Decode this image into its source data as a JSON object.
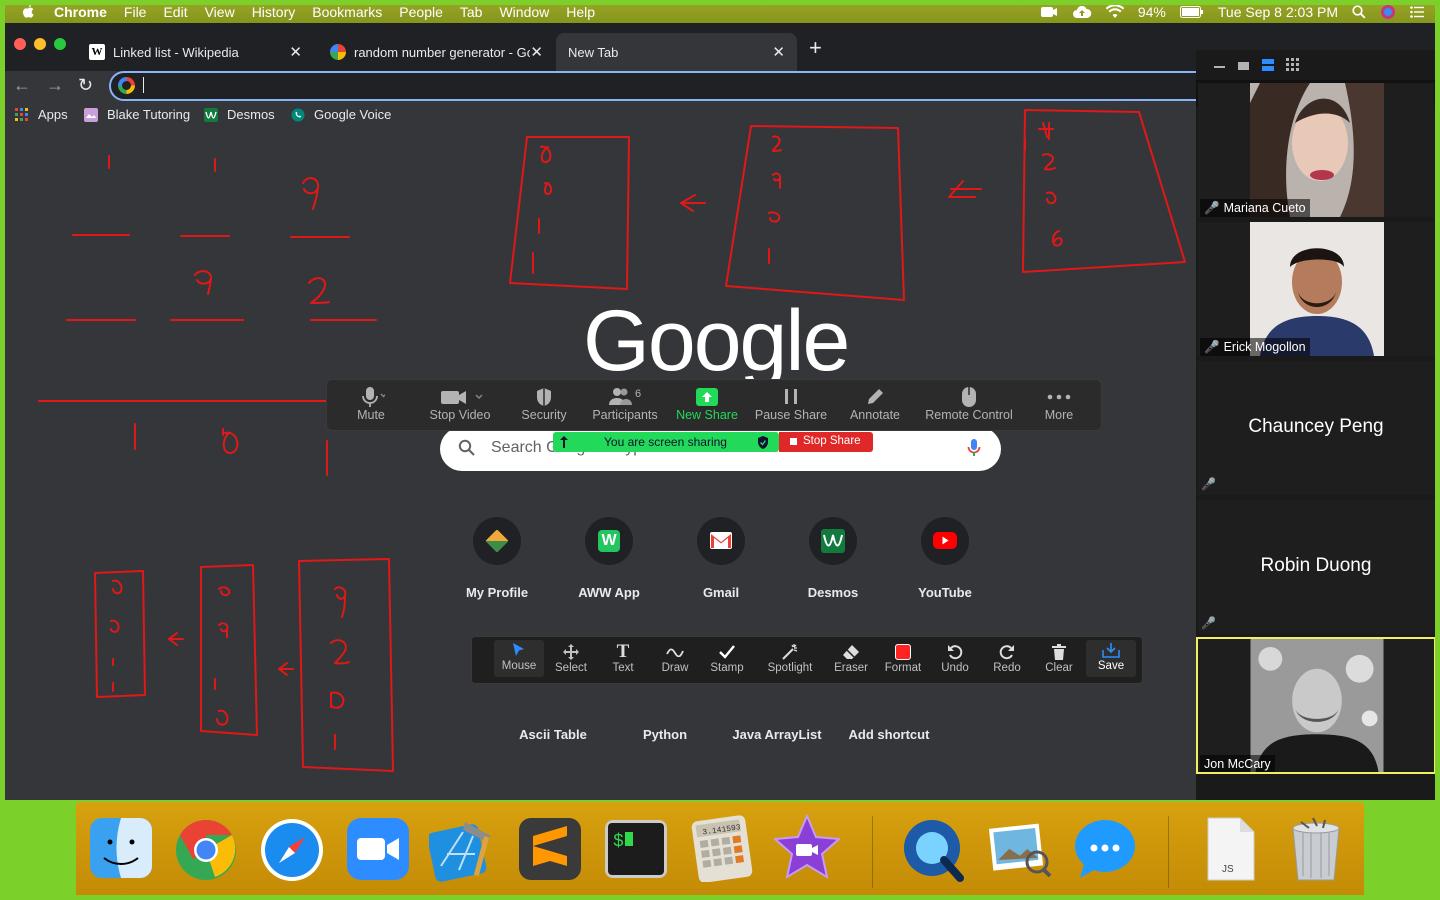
{
  "menubar": {
    "app": "Chrome",
    "items": [
      "File",
      "Edit",
      "View",
      "History",
      "Bookmarks",
      "People",
      "Tab",
      "Window",
      "Help"
    ],
    "battery": "94%",
    "datetime": "Tue Sep 8  2:03 PM"
  },
  "tabs": [
    {
      "title": "Linked list - Wikipedia",
      "favicon": "W"
    },
    {
      "title": "random number generator - Go",
      "favicon": "G"
    },
    {
      "title": "New Tab",
      "favicon": ""
    }
  ],
  "omnibox": {
    "value": ""
  },
  "bookmarks": [
    {
      "label": "Apps",
      "icon": "apps-grid-icon"
    },
    {
      "label": "Blake Tutoring",
      "icon": "blake-tutoring-icon"
    },
    {
      "label": "Desmos",
      "icon": "desmos-icon"
    },
    {
      "label": "Google Voice",
      "icon": "google-voice-icon"
    }
  ],
  "google": {
    "logo": "Google",
    "search_placeholder": "Search Google or type a URL"
  },
  "shortcuts_row1": [
    {
      "label": "My Profile",
      "color": "#f2a93b"
    },
    {
      "label": "AWW App",
      "color": "#22c55e"
    },
    {
      "label": "Gmail",
      "color": "#ea4335"
    },
    {
      "label": "Desmos",
      "color": "#127a3d"
    },
    {
      "label": "YouTube",
      "color": "#ff0000"
    }
  ],
  "shortcuts_row2": [
    {
      "label": "Ascii Table"
    },
    {
      "label": "Python"
    },
    {
      "label": "Java ArrayList"
    },
    {
      "label": "Add shortcut"
    }
  ],
  "zoom_toolbar": {
    "buttons": [
      {
        "label": "Mute",
        "icon": "microphone-icon"
      },
      {
        "label": "Stop Video",
        "icon": "video-camera-icon"
      },
      {
        "label": "Security",
        "icon": "shield-icon"
      },
      {
        "label": "Participants",
        "icon": "participants-icon",
        "count": "6"
      },
      {
        "label": "New Share",
        "icon": "share-screen-icon"
      },
      {
        "label": "Pause Share",
        "icon": "pause-icon"
      },
      {
        "label": "Annotate",
        "icon": "pencil-icon"
      },
      {
        "label": "Remote Control",
        "icon": "mouse-icon"
      },
      {
        "label": "More",
        "icon": "ellipsis-icon"
      }
    ],
    "sharing_status": "You are screen sharing",
    "stop_share": "Stop Share"
  },
  "annotate_toolbar": {
    "tools": [
      {
        "label": "Mouse",
        "icon": "cursor-icon"
      },
      {
        "label": "Select",
        "icon": "move-icon"
      },
      {
        "label": "Text",
        "icon": "text-icon"
      },
      {
        "label": "Draw",
        "icon": "squiggle-icon"
      },
      {
        "label": "Stamp",
        "icon": "checkmark-icon"
      },
      {
        "label": "Spotlight",
        "icon": "spotlight-icon"
      },
      {
        "label": "Eraser",
        "icon": "eraser-icon"
      },
      {
        "label": "Format",
        "icon": "format-icon"
      },
      {
        "label": "Undo",
        "icon": "undo-icon"
      },
      {
        "label": "Redo",
        "icon": "redo-icon"
      },
      {
        "label": "Clear",
        "icon": "trash-icon"
      },
      {
        "label": "Save",
        "icon": "save-icon"
      }
    ]
  },
  "participants": [
    {
      "name": "Mariana Cueto",
      "video": true
    },
    {
      "name": "Erick Mogollon",
      "video": true
    },
    {
      "name": "Chauncey Peng",
      "video": false
    },
    {
      "name": "Robin Duong",
      "video": false
    },
    {
      "name": "Jon McCary",
      "video": true
    }
  ],
  "dock": [
    {
      "name": "finder-icon"
    },
    {
      "name": "chrome-icon"
    },
    {
      "name": "safari-icon"
    },
    {
      "name": "zoom-icon"
    },
    {
      "name": "xcode-icon"
    },
    {
      "name": "sublime-text-icon"
    },
    {
      "name": "terminal-icon"
    },
    {
      "name": "calculator-icon",
      "display": "3.141593"
    },
    {
      "name": "imovie-icon"
    },
    {
      "name": "quicktime-icon"
    },
    {
      "name": "preview-icon"
    },
    {
      "name": "messages-icon"
    },
    {
      "name": "js-file-icon",
      "label": "JS"
    },
    {
      "name": "trash-icon"
    }
  ]
}
